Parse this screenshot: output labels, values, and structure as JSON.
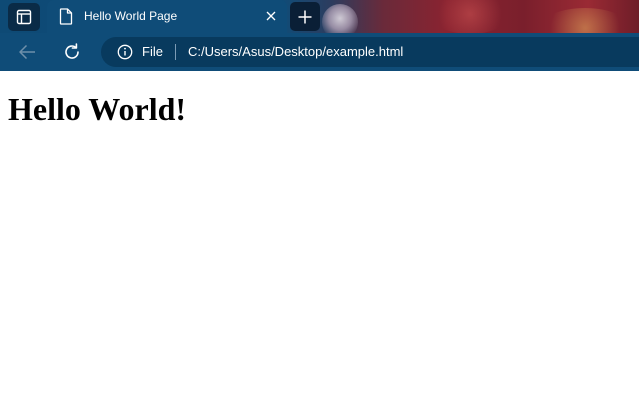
{
  "tab": {
    "title": "Hello World Page"
  },
  "address_bar": {
    "scheme_label": "File",
    "url": "C:/Users/Asus/Desktop/example.html"
  },
  "page": {
    "heading": "Hello World!"
  },
  "icons": {
    "tab_actions": "tab-actions-icon",
    "page": "page-icon",
    "close": "close-icon",
    "new_tab": "plus-icon",
    "back": "back-arrow-icon",
    "refresh": "refresh-icon",
    "info": "info-icon"
  },
  "colors": {
    "toolbar": "#0f4c78",
    "address_bar": "#083a5e",
    "page_background": "#ffffff"
  }
}
